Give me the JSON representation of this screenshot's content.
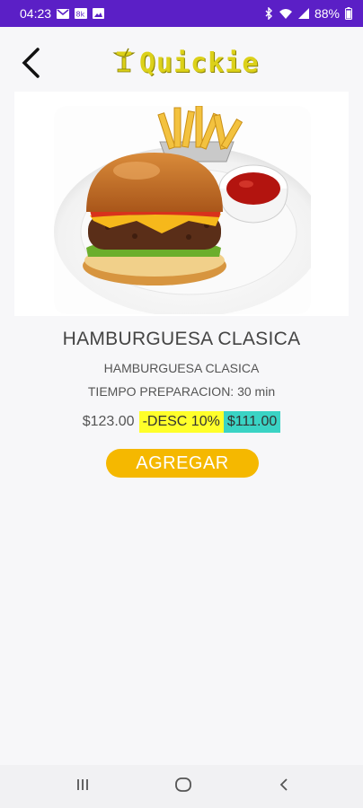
{
  "status_bar": {
    "time": "04:23",
    "battery": "88%",
    "left_icons": [
      "mail-icon",
      "signal-88k-icon",
      "image-icon"
    ],
    "right_icons": [
      "bluetooth-icon",
      "wifi-icon",
      "cell-signal-icon",
      "battery-icon"
    ]
  },
  "header": {
    "app_name": "Quickie",
    "back_icon": "arrow-back-icon",
    "logo_icon": "cocktail-glass-icon"
  },
  "product": {
    "name": "HAMBURGUESA CLASICA",
    "description": "HAMBURGUESA CLASICA",
    "prep_time": "TIEMPO PREPARACION: 30 min",
    "price": "$123.00",
    "discount": "-DESC 10%",
    "final_price": "$111.00",
    "image_icon": "hamburger-fries-photo"
  },
  "actions": {
    "add_label": "AGREGAR"
  },
  "nav_bar": {
    "recents_icon": "recents-icon",
    "home_icon": "home-icon",
    "back_icon": "back-icon"
  },
  "colors": {
    "status_bar": "#5b1fc6",
    "logo": "#dcd11a",
    "add_button": "#f5b800",
    "discount_bg": "#ffff2a",
    "final_price_bg": "#3ad3c4"
  }
}
